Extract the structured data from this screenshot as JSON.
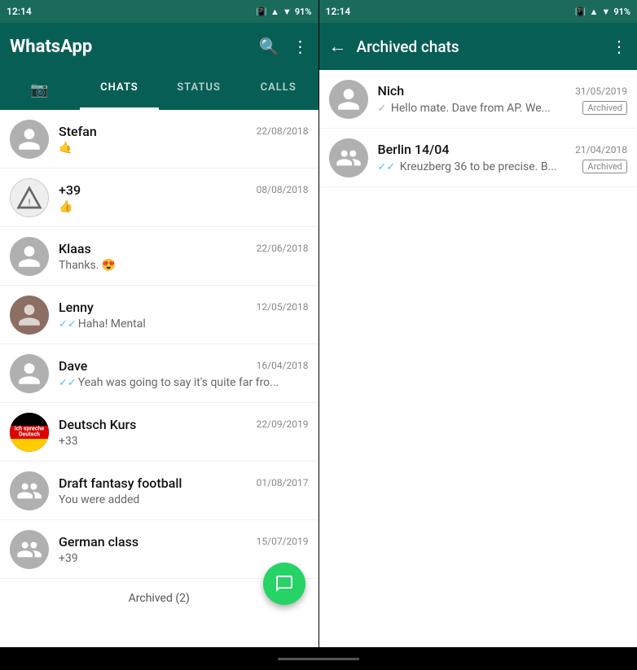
{
  "left": {
    "statusBar": {
      "time": "12:14",
      "battery": "91%"
    },
    "header": {
      "title": "WhatsApp",
      "searchLabel": "search",
      "menuLabel": "menu"
    },
    "tabs": [
      {
        "id": "camera",
        "label": "📷",
        "isIcon": true,
        "active": false
      },
      {
        "id": "chats",
        "label": "CHATS",
        "active": true
      },
      {
        "id": "status",
        "label": "STATUS",
        "active": false
      },
      {
        "id": "calls",
        "label": "CALLS",
        "active": false
      }
    ],
    "chats": [
      {
        "id": "stefan",
        "name": "Stefan",
        "time": "22/08/2018",
        "preview": "🤙",
        "avatarType": "person"
      },
      {
        "id": "plus39",
        "name": "+39",
        "time": "08/08/2018",
        "preview": "👍",
        "avatarType": "triangle"
      },
      {
        "id": "klaas",
        "name": "Klaas",
        "time": "22/06/2018",
        "preview": "Thanks. 😍",
        "avatarType": "person"
      },
      {
        "id": "lenny",
        "name": "Lenny",
        "time": "12/05/2018",
        "preview": "✓✓Haha! Mental",
        "avatarType": "lenny",
        "hasCheck": true
      },
      {
        "id": "dave",
        "name": "Dave",
        "time": "16/04/2018",
        "preview": "✓✓Yeah was going to say it's quite far fro...",
        "avatarType": "person",
        "hasCheck": true
      },
      {
        "id": "deutsch",
        "name": "Deutsch Kurs",
        "time": "22/09/2019",
        "preview": "+33",
        "avatarType": "deutsch"
      },
      {
        "id": "draft",
        "name": "Draft fantasy football",
        "time": "01/08/2017",
        "preview": "You were added",
        "avatarType": "group"
      },
      {
        "id": "german",
        "name": "German class",
        "time": "15/07/2019",
        "preview": "+39",
        "avatarType": "group"
      }
    ],
    "archivedLabel": "Archived (2)",
    "fabLabel": "new chat"
  },
  "right": {
    "statusBar": {
      "time": "12:14",
      "battery": "91%"
    },
    "header": {
      "backLabel": "back",
      "title": "Archived chats",
      "menuLabel": "menu"
    },
    "chats": [
      {
        "id": "nich",
        "name": "Nich",
        "time": "31/05/2019",
        "preview": "Hello mate. Dave from AP. We...",
        "avatarType": "person",
        "hasCheck": true,
        "checkCount": 1,
        "archived": true,
        "archivedLabel": "Archived"
      },
      {
        "id": "berlin",
        "name": "Berlin 14/04",
        "time": "21/04/2018",
        "preview": "Kreuzberg 36 to be precise. B...",
        "avatarType": "group",
        "hasCheck": true,
        "checkCount": 2,
        "archived": true,
        "archivedLabel": "Archived"
      }
    ]
  }
}
